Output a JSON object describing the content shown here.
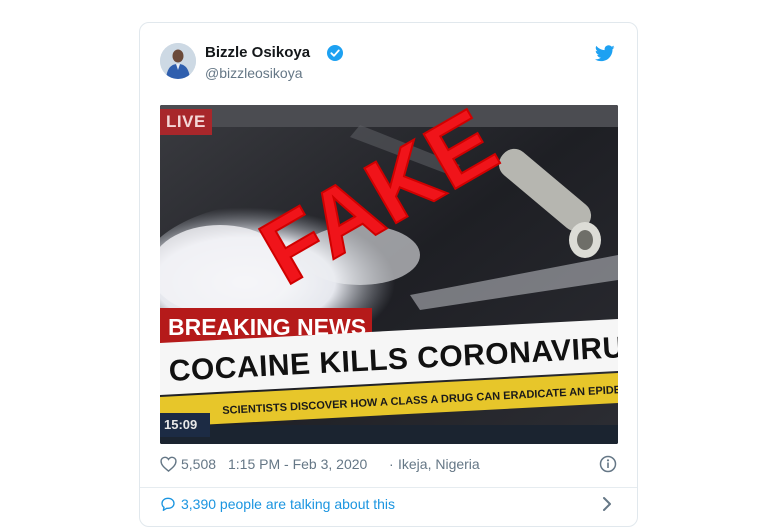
{
  "tweet": {
    "display_name": "Bizzle Osikoya",
    "handle": "@bizzleosikoya",
    "verified": true,
    "likes": "5,508",
    "timestamp": "1:15 PM - Feb 3, 2020",
    "separator": "·",
    "location": "Ikeja, Nigeria",
    "talking": "3,390 people are talking about this"
  },
  "media": {
    "live_badge": "LIVE",
    "stamp": "FAKE",
    "breaking": "BREAKING NEWS",
    "headline": "COCAINE KILLS CORONAVIRUS",
    "ticker": "SCIENTISTS DISCOVER HOW A CLASS A DRUG CAN ERADICATE AN EPIDEMIC",
    "clock": "15:09"
  },
  "colors": {
    "accent": "#1da1f2",
    "link": "#1b95e0",
    "muted": "#657786",
    "stamp_red": "#f0141a"
  },
  "icons": [
    "verified-icon",
    "twitter-bird-icon",
    "heart-icon",
    "info-icon",
    "comment-icon",
    "chevron-right-icon"
  ]
}
